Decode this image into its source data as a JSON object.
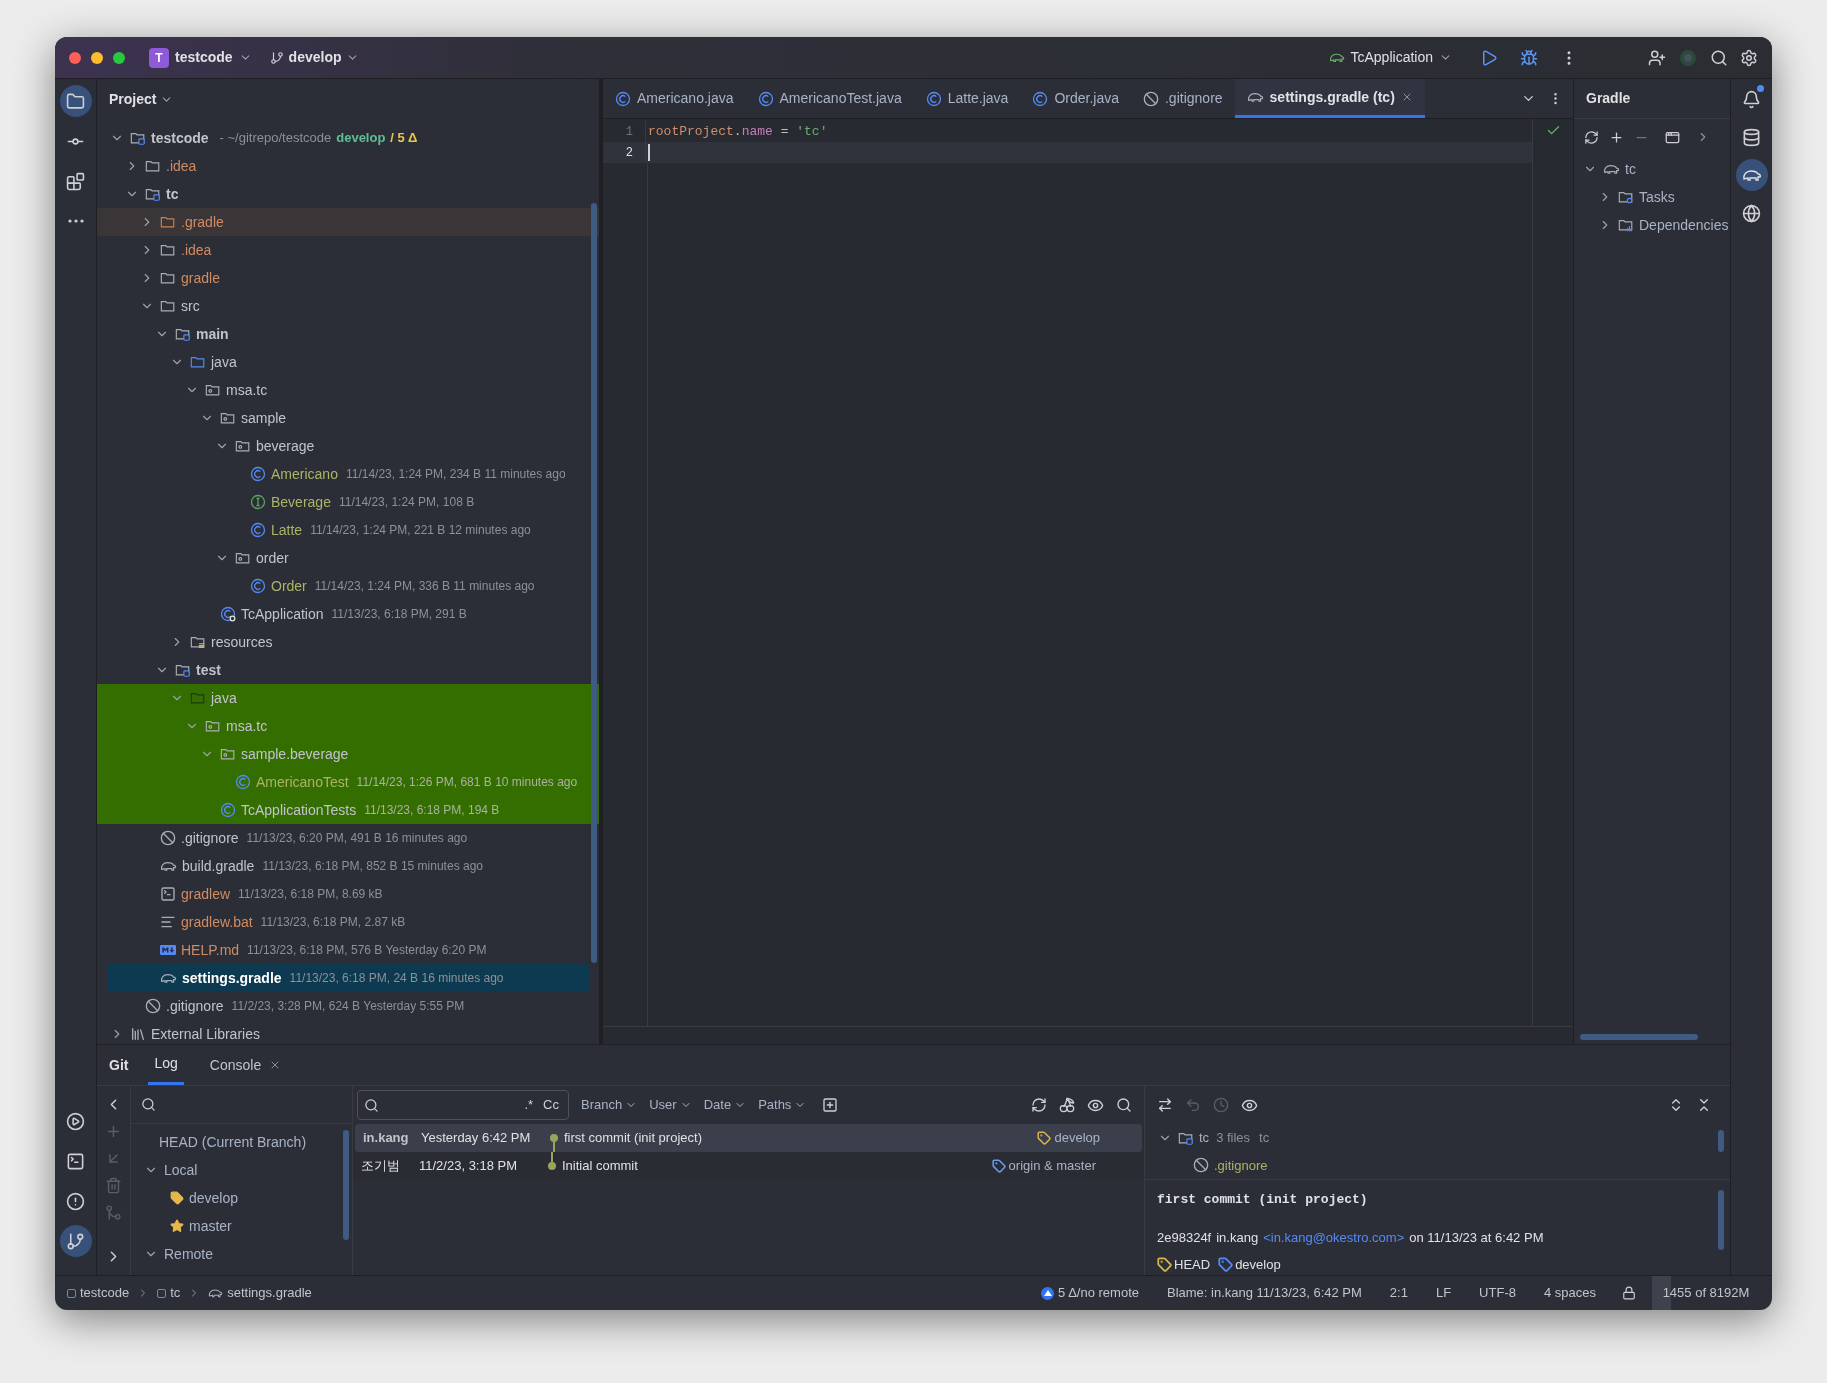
{
  "window": {
    "project_badge": "T",
    "project": "testcode",
    "branch": "develop",
    "run_config": "TcApplication"
  },
  "left_stripe": {
    "top": [
      {
        "kind": "project",
        "selected": true
      },
      {
        "kind": "commit",
        "selected": false
      },
      {
        "kind": "structure",
        "selected": false
      },
      {
        "kind": "more",
        "selected": false
      }
    ],
    "bottom": [
      {
        "kind": "services",
        "selected": false
      },
      {
        "kind": "terminal",
        "selected": false
      },
      {
        "kind": "problems",
        "selected": false
      },
      {
        "kind": "git",
        "selected": true
      }
    ]
  },
  "right_stripe": [
    {
      "kind": "notifications",
      "selected": false,
      "unread": true
    },
    {
      "kind": "database",
      "selected": false,
      "unread": false
    },
    {
      "kind": "gradle",
      "selected": true,
      "unread": false
    },
    {
      "kind": "plugin",
      "selected": false,
      "unread": false
    }
  ],
  "project_panel": {
    "title": "Project",
    "tree": [
      {
        "name": "testcode",
        "kind": "module",
        "path": "- ~/gitrepo/testcode",
        "branch": "develop",
        "changes": "/ 5 Δ",
        "color": "#c1c4cb",
        "expanded": true,
        "selected": false,
        "children": [
          {
            "name": ".idea",
            "kind": "folder",
            "color": "#d08b63",
            "expanded": false,
            "selected": false
          },
          {
            "name": "tc",
            "kind": "module",
            "color": "#c1c4cb",
            "expanded": true,
            "selected": false,
            "children": [
              {
                "name": ".gradle",
                "kind": "excluded-folder",
                "color": "#d08b63",
                "expanded": false,
                "selected": false,
                "hovered": true
              },
              {
                "name": ".idea",
                "kind": "folder",
                "color": "#d08b63",
                "expanded": false,
                "selected": false
              },
              {
                "name": "gradle",
                "kind": "folder",
                "color": "#d08b63",
                "expanded": false,
                "selected": false
              },
              {
                "name": "src",
                "kind": "folder",
                "color": "#c1c4cb",
                "expanded": true,
                "selected": false,
                "children": [
                  {
                    "name": "main",
                    "kind": "module",
                    "color": "#c1c4cb",
                    "expanded": true,
                    "selected": false,
                    "children": [
                      {
                        "name": "java",
                        "kind": "source-folder",
                        "color": "#c1c4cb",
                        "expanded": true,
                        "selected": false,
                        "children": [
                          {
                            "name": "msa.tc",
                            "kind": "package",
                            "color": "#c1c4cb",
                            "expanded": true,
                            "selected": false,
                            "children": [
                              {
                                "name": "sample",
                                "kind": "package",
                                "color": "#c1c4cb",
                                "expanded": true,
                                "selected": false,
                                "children": [
                                  {
                                    "name": "beverage",
                                    "kind": "package",
                                    "color": "#c1c4cb",
                                    "expanded": true,
                                    "selected": false,
                                    "children": [
                                      {
                                        "name": "Americano",
                                        "kind": "class",
                                        "meta": "11/14/23, 1:24 PM, 234 B 11 minutes ago",
                                        "color": "#aab467",
                                        "selected": false
                                      },
                                      {
                                        "name": "Beverage",
                                        "kind": "interface",
                                        "meta": "11/14/23, 1:24 PM, 108 B",
                                        "color": "#aab467",
                                        "selected": false
                                      },
                                      {
                                        "name": "Latte",
                                        "kind": "class",
                                        "meta": "11/14/23, 1:24 PM, 221 B 12 minutes ago",
                                        "color": "#aab467",
                                        "selected": false
                                      }
                                    ]
                                  },
                                  {
                                    "name": "order",
                                    "kind": "package",
                                    "color": "#c1c4cb",
                                    "expanded": true,
                                    "selected": false,
                                    "children": [
                                      {
                                        "name": "Order",
                                        "kind": "class",
                                        "meta": "11/14/23, 1:24 PM, 336 B 11 minutes ago",
                                        "color": "#aab467",
                                        "selected": false
                                      }
                                    ]
                                  }
                                ]
                              },
                              {
                                "name": "TcApplication",
                                "kind": "app-class",
                                "meta": "11/13/23, 6:18 PM, 291 B",
                                "color": "#c1c4cb",
                                "selected": false
                              }
                            ]
                          }
                        ]
                      },
                      {
                        "name": "resources",
                        "kind": "resources",
                        "color": "#c1c4cb",
                        "expanded": false,
                        "selected": false
                      }
                    ]
                  },
                  {
                    "name": "test",
                    "kind": "module",
                    "color": "#c1c4cb",
                    "expanded": true,
                    "selected": false,
                    "children": [
                      {
                        "name": "java",
                        "kind": "test-folder",
                        "color": "#c1c4cb",
                        "expanded": true,
                        "selected": false,
                        "test_root": true,
                        "children": [
                          {
                            "name": "msa.tc",
                            "kind": "package",
                            "color": "#c1c4cb",
                            "expanded": true,
                            "selected": false,
                            "test_root": true,
                            "children": [
                              {
                                "name": "sample.beverage",
                                "kind": "package",
                                "color": "#c1c4cb",
                                "expanded": true,
                                "selected": false,
                                "test_root": true,
                                "children": [
                                  {
                                    "name": "AmericanoTest",
                                    "kind": "class",
                                    "meta": "11/14/23, 1:26 PM, 681 B 10 minutes ago",
                                    "color": "#aab467",
                                    "selected": false,
                                    "test_root": true
                                  }
                                ]
                              },
                              {
                                "name": "TcApplicationTests",
                                "kind": "class",
                                "meta": "11/13/23, 6:18 PM, 194 B",
                                "color": "#c1c4cb",
                                "selected": false,
                                "test_root": true
                              }
                            ]
                          }
                        ]
                      }
                    ]
                  }
                ]
              },
              {
                "name": ".gitignore",
                "kind": "gitignore",
                "meta": "11/13/23, 6:20 PM, 491 B 16 minutes ago",
                "color": "#c1c4cb",
                "selected": false
              },
              {
                "name": "build.gradle",
                "kind": "gradle",
                "meta": "11/13/23, 6:18 PM, 852 B 15 minutes ago",
                "color": "#c1c4cb",
                "selected": false
              },
              {
                "name": "gradlew",
                "kind": "script",
                "meta": "11/13/23, 6:18 PM, 8.69 kB",
                "color": "#d08b63",
                "selected": false
              },
              {
                "name": "gradlew.bat",
                "kind": "text",
                "meta": "11/13/23, 6:18 PM, 2.87 kB",
                "color": "#d08b63",
                "selected": false
              },
              {
                "name": "HELP.md",
                "kind": "markdown",
                "meta": "11/13/23, 6:18 PM, 576 B Yesterday 6:20 PM",
                "color": "#d08b63",
                "selected": false
              },
              {
                "name": "settings.gradle",
                "kind": "gradle",
                "meta": "11/13/23, 6:18 PM, 24 B 16 minutes ago",
                "color": "#ffffff",
                "selected": true
              }
            ]
          },
          {
            "name": ".gitignore",
            "kind": "gitignore",
            "meta": "11/2/23, 3:28 PM, 624 B Yesterday 5:55 PM",
            "color": "#c1c4cb",
            "selected": false
          }
        ]
      },
      {
        "name": "External Libraries",
        "kind": "library",
        "color": "#c1c4cb",
        "expanded": false,
        "selected": false
      }
    ]
  },
  "editor": {
    "tabs": [
      {
        "label": "Americano.java",
        "kind": "class",
        "selected": false
      },
      {
        "label": "AmericanoTest.java",
        "kind": "class",
        "selected": false
      },
      {
        "label": "Latte.java",
        "kind": "class",
        "selected": false
      },
      {
        "label": "Order.java",
        "kind": "class",
        "selected": false
      },
      {
        "label": ".gitignore",
        "kind": "gitignore",
        "selected": false
      },
      {
        "label": "settings.gradle (tc)",
        "kind": "gradle",
        "selected": true
      }
    ],
    "lines": [
      {
        "number": "1",
        "current": false,
        "tokens": [
          {
            "text": "rootProject",
            "kind": "keyword"
          },
          {
            "text": ".",
            "kind": "plain"
          },
          {
            "text": "name",
            "kind": "property"
          },
          {
            "text": " = ",
            "kind": "plain"
          },
          {
            "text": "'tc'",
            "kind": "string"
          }
        ]
      },
      {
        "number": "2",
        "current": true
      }
    ]
  },
  "gradle_panel": {
    "title": "Gradle",
    "tree": [
      {
        "name": "tc",
        "kind": "gradle",
        "expanded": true,
        "children": [
          {
            "name": "Tasks",
            "kind": "tasks",
            "expanded": false
          },
          {
            "name": "Dependencies",
            "kind": "dependencies",
            "expanded": false
          }
        ]
      }
    ]
  },
  "git_panel": {
    "title": "Git",
    "tabs": [
      {
        "label": "Log",
        "selected": true,
        "closable": false
      },
      {
        "label": "Console",
        "selected": false,
        "closable": true
      }
    ],
    "branches": [
      {
        "label": "HEAD (Current Branch)",
        "kind": "head"
      },
      {
        "label": "Local",
        "kind": "group",
        "expanded": true,
        "children": [
          {
            "label": "develop",
            "kind": "current"
          },
          {
            "label": "master",
            "kind": "favorite"
          }
        ]
      },
      {
        "label": "Remote",
        "kind": "group",
        "expanded": true
      }
    ],
    "filter": {
      "regex": ".*",
      "match_case": "Cc",
      "dropdowns": [
        "Branch",
        "User",
        "Date",
        "Paths"
      ]
    },
    "commits": [
      {
        "author": "in.kang",
        "mine": true,
        "date": "Yesterday 6:42 PM",
        "message": "first commit (init project)",
        "ref": "develop",
        "color": "#d9b44a",
        "selected": true
      },
      {
        "author": "조기범",
        "mine": false,
        "date": "11/2/23, 3:18 PM",
        "message": "Initial commit",
        "ref": "origin & master",
        "color": "#6b9ee8",
        "selected": false
      }
    ],
    "changes": {
      "name": "tc",
      "count": "3 files",
      "module": "tc",
      "expanded": true,
      "files": [
        {
          "name": ".gitignore",
          "color": "#aab467"
        }
      ]
    },
    "details": {
      "subject": "first commit (init project)",
      "hash": "2e98324f",
      "author": "in.kang",
      "email": "<in.kang@okestro.com>",
      "when": "on 11/13/23 at 6:42 PM",
      "refs": [
        {
          "label": "HEAD",
          "color": "#d9b44a"
        },
        {
          "label": "develop",
          "color": "#548af7"
        }
      ]
    }
  },
  "status_bar": {
    "breadcrumbs": [
      {
        "label": "testcode",
        "kind": "module"
      },
      {
        "label": "tc",
        "kind": "module"
      },
      {
        "label": "settings.gradle",
        "kind": "gradle"
      }
    ],
    "vcs": "5 Δ/no remote",
    "items": [
      "Blame: in.kang 11/13/23, 6:42 PM",
      "2:1",
      "LF",
      "UTF-8",
      "4 spaces"
    ],
    "memory": {
      "text": "1455 of 8192M",
      "level": 0.18
    }
  }
}
